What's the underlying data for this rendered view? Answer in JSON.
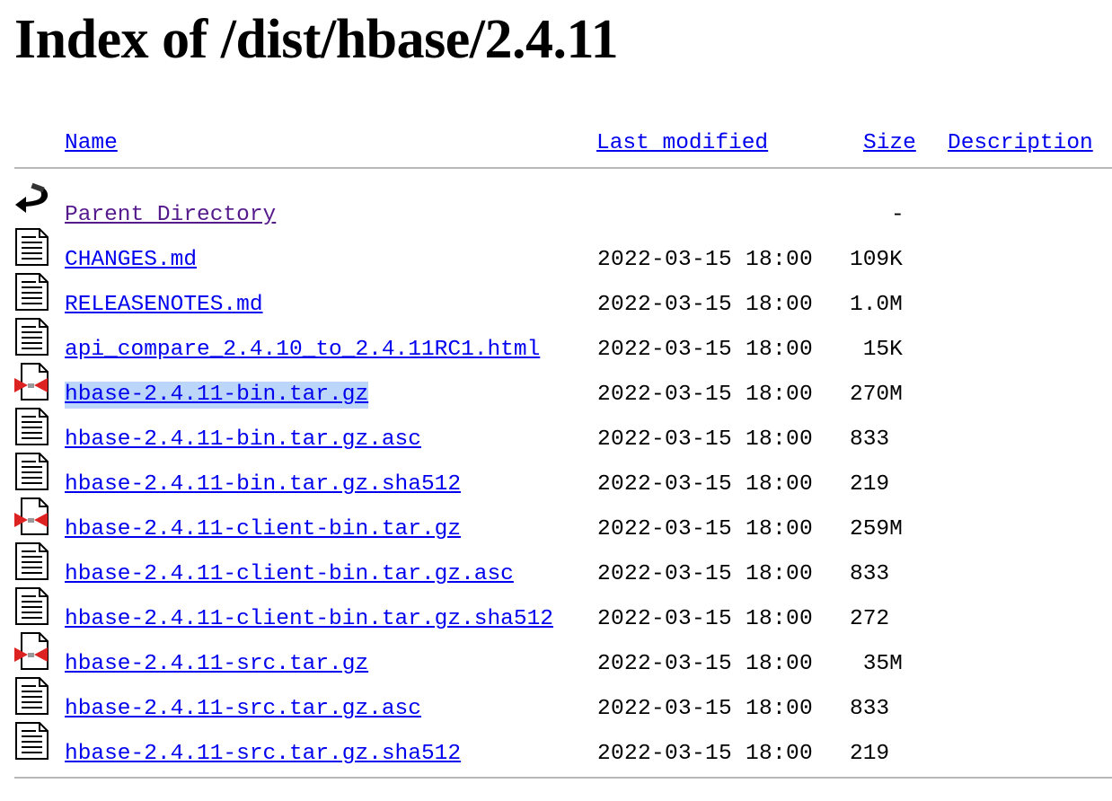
{
  "title": "Index of /dist/hbase/2.4.11",
  "columns": {
    "name": "Name",
    "last_modified": "Last modified",
    "size": "Size",
    "description": "Description"
  },
  "parent": {
    "label": "Parent Directory",
    "size": "-",
    "icon": "back-icon"
  },
  "rows": [
    {
      "name": "CHANGES.md",
      "modified": "2022-03-15 18:00",
      "size": "109K",
      "icon": "text-file-icon"
    },
    {
      "name": "RELEASENOTES.md",
      "modified": "2022-03-15 18:00",
      "size": "1.0M",
      "icon": "text-file-icon"
    },
    {
      "name": "api_compare_2.4.10_to_2.4.11RC1.html",
      "modified": "2022-03-15 18:00",
      "size": " 15K",
      "icon": "text-file-icon"
    },
    {
      "name": "hbase-2.4.11-bin.tar.gz",
      "modified": "2022-03-15 18:00",
      "size": "270M",
      "icon": "compressed-file-icon"
    },
    {
      "name": "hbase-2.4.11-bin.tar.gz.asc",
      "modified": "2022-03-15 18:00",
      "size": "833",
      "icon": "text-file-icon"
    },
    {
      "name": "hbase-2.4.11-bin.tar.gz.sha512",
      "modified": "2022-03-15 18:00",
      "size": "219",
      "icon": "text-file-icon"
    },
    {
      "name": "hbase-2.4.11-client-bin.tar.gz",
      "modified": "2022-03-15 18:00",
      "size": "259M",
      "icon": "compressed-file-icon"
    },
    {
      "name": "hbase-2.4.11-client-bin.tar.gz.asc",
      "modified": "2022-03-15 18:00",
      "size": "833",
      "icon": "text-file-icon"
    },
    {
      "name": "hbase-2.4.11-client-bin.tar.gz.sha512",
      "modified": "2022-03-15 18:00",
      "size": "272",
      "icon": "text-file-icon"
    },
    {
      "name": "hbase-2.4.11-src.tar.gz",
      "modified": "2022-03-15 18:00",
      "size": " 35M",
      "icon": "compressed-file-icon"
    },
    {
      "name": "hbase-2.4.11-src.tar.gz.asc",
      "modified": "2022-03-15 18:00",
      "size": "833",
      "icon": "text-file-icon"
    },
    {
      "name": "hbase-2.4.11-src.tar.gz.sha512",
      "modified": "2022-03-15 18:00",
      "size": "219",
      "icon": "text-file-icon"
    }
  ],
  "colors": {
    "link": "#0000ee",
    "visited_link": "#551a8b",
    "selection_highlight": "#bcd6fa",
    "rule": "#b8b8b8"
  }
}
